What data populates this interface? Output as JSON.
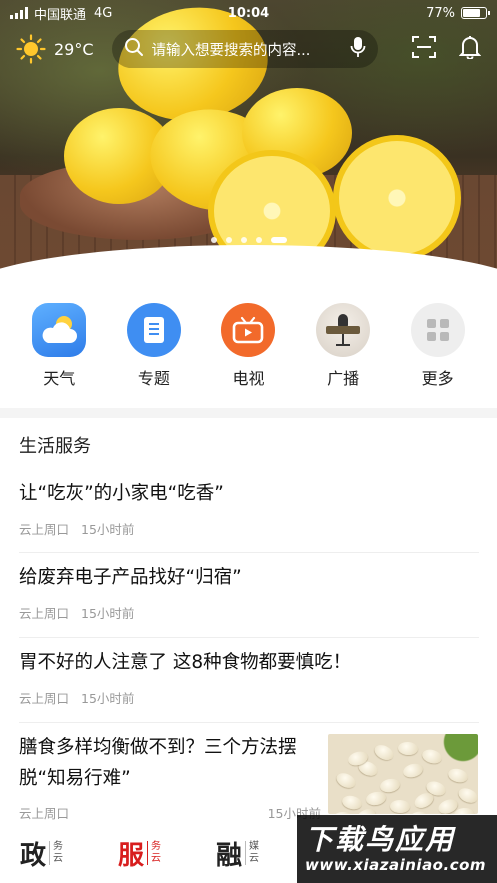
{
  "status_bar": {
    "carrier": "中国联通",
    "network": "4G",
    "time": "10:04",
    "battery_percent": "77%",
    "battery_level": 0.77
  },
  "top_bar": {
    "weather": {
      "icon": "sun-icon",
      "temperature": "29°C"
    },
    "search": {
      "icon": "search-icon",
      "placeholder": "请输入想要搜索的内容...",
      "voice_icon": "microphone-icon"
    },
    "scan_icon": "scan-icon",
    "bell_icon": "bell-icon"
  },
  "carousel": {
    "slide_count": 5,
    "active_index": 4
  },
  "quick_nav": [
    {
      "label": "天气",
      "icon": "weather-icon",
      "color": "#3a8ff0"
    },
    {
      "label": "专题",
      "icon": "document-icon",
      "color": "#3f8ef2"
    },
    {
      "label": "电视",
      "icon": "tv-icon",
      "color": "#f26a2b"
    },
    {
      "label": "广播",
      "icon": "radio-icon",
      "color": "#e8e2dc"
    },
    {
      "label": "更多",
      "icon": "more-grid-icon",
      "color": "#eeeeee"
    }
  ],
  "section_title": "生活服务",
  "news": [
    {
      "title": "让“吃灰”的小家电“吃香”",
      "source": "云上周口",
      "time": "15小时前"
    },
    {
      "title": "给废弃电子产品找好“归宿”",
      "source": "云上周口",
      "time": "15小时前"
    },
    {
      "title": "胃不好的人注意了 这8种食物都要慎吃！",
      "source": "云上周口",
      "time": "15小时前"
    },
    {
      "title": "膳食多样均衡做不到？三个方法摆脱“知易行难”",
      "source": "云上周口",
      "time": "15小时前"
    }
  ],
  "bottom_nav": [
    {
      "big": "政",
      "small1": "务",
      "small2": "云"
    },
    {
      "big": "服",
      "small1": "务",
      "small2": "云"
    },
    {
      "big": "融",
      "small1": "媒",
      "small2": "云"
    }
  ],
  "watermark": {
    "line1": "下载鸟应用",
    "line2": "www.xiazainiao.com"
  },
  "colors": {
    "active_tab": "#d81e1e",
    "meta_text": "#999999"
  }
}
